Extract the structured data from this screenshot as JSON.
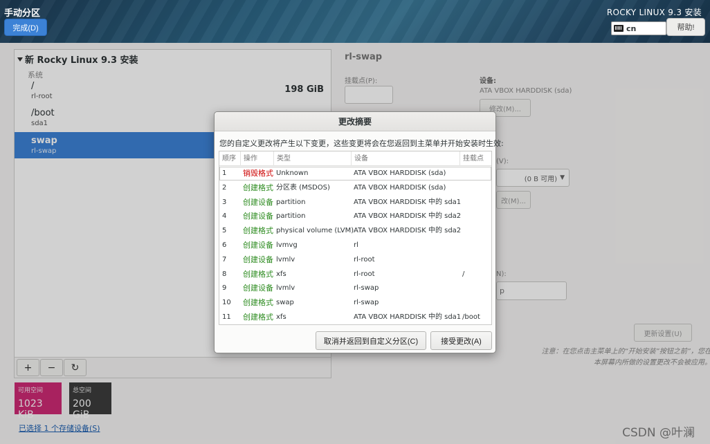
{
  "header": {
    "spoke_title": "手动分区",
    "done_label": "完成(D)",
    "product_title": "ROCKY LINUX 9.3 安装",
    "keyboard_layout": "cn",
    "help_label": "帮助!"
  },
  "left": {
    "install_title": "新 Rocky Linux 9.3 安装",
    "group_label": "系统",
    "partitions": [
      {
        "mount": "/",
        "device": "rl-root",
        "size": "198 GiB"
      },
      {
        "mount": "/boot",
        "device": "sda1",
        "size": ""
      },
      {
        "mount": "swap",
        "device": "rl-swap",
        "size": ""
      }
    ],
    "toolbar": {
      "add": "+",
      "remove": "−",
      "refresh": "↻"
    },
    "available_label": "可用空间",
    "available_value": "1023 KiB",
    "total_label": "总空间",
    "total_value": "200 GiB",
    "storage_link": "已选择 1 个存储设备(S)"
  },
  "right": {
    "title": "rl-swap",
    "mount_point_label": "挂载点(P):",
    "device_label": "设备:",
    "device_value": "ATA VBOX HARDDISK (sda)",
    "modify_label": "修改(M)...",
    "volume_group_suffix": "(V):",
    "vg_free": "(0 B 可用)",
    "modify2_label": "改(M)...",
    "name_suffix": "N):",
    "name_value": "p",
    "update_label": "更新设置(U)",
    "note": "注意：在您点击主菜单上的“开始安装”按钮之前”，您在本屏幕内所做的设置更改不会被应用。"
  },
  "dialog": {
    "title": "更改摘要",
    "message": "您的自定义更改将产生以下变更，这些变更将会在您返回到主菜单并开始安装时生效:",
    "columns": [
      "顺序",
      "操作",
      "类型",
      "设备",
      "挂载点"
    ],
    "rows": [
      {
        "order": "1",
        "action": "销毁格式",
        "type": "Unknown",
        "device": "ATA VBOX HARDDISK (sda)",
        "mount": "",
        "kind": "destroy"
      },
      {
        "order": "2",
        "action": "创建格式",
        "type": "分区表 (MSDOS)",
        "device": "ATA VBOX HARDDISK (sda)",
        "mount": "",
        "kind": "create"
      },
      {
        "order": "3",
        "action": "创建设备",
        "type": "partition",
        "device": "ATA VBOX HARDDISK 中的 sda1",
        "mount": "",
        "kind": "create"
      },
      {
        "order": "4",
        "action": "创建设备",
        "type": "partition",
        "device": "ATA VBOX HARDDISK 中的 sda2",
        "mount": "",
        "kind": "create"
      },
      {
        "order": "5",
        "action": "创建格式",
        "type": "physical volume (LVM)",
        "device": "ATA VBOX HARDDISK 中的 sda2",
        "mount": "",
        "kind": "create"
      },
      {
        "order": "6",
        "action": "创建设备",
        "type": "lvmvg",
        "device": "rl",
        "mount": "",
        "kind": "create"
      },
      {
        "order": "7",
        "action": "创建设备",
        "type": "lvmlv",
        "device": "rl-root",
        "mount": "",
        "kind": "create"
      },
      {
        "order": "8",
        "action": "创建格式",
        "type": "xfs",
        "device": "rl-root",
        "mount": "/",
        "kind": "create"
      },
      {
        "order": "9",
        "action": "创建设备",
        "type": "lvmlv",
        "device": "rl-swap",
        "mount": "",
        "kind": "create"
      },
      {
        "order": "10",
        "action": "创建格式",
        "type": "swap",
        "device": "rl-swap",
        "mount": "",
        "kind": "create"
      },
      {
        "order": "11",
        "action": "创建格式",
        "type": "xfs",
        "device": "ATA VBOX HARDDISK 中的 sda1",
        "mount": "/boot",
        "kind": "create"
      }
    ],
    "cancel_label": "取消并返回到自定义分区(C)",
    "accept_label": "接受更改(A)",
    "colors": {
      "destroy": "#cc0000",
      "create": "#2c8b1f"
    }
  },
  "watermark": "CSDN @叶澜"
}
